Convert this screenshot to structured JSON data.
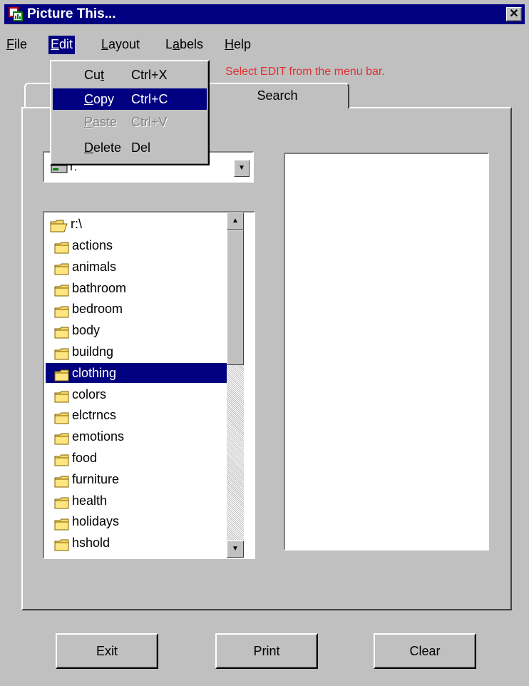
{
  "window": {
    "title": "Picture This...",
    "close_glyph": "✕"
  },
  "menubar": [
    {
      "label": "File",
      "ul": "F",
      "rest": "ile"
    },
    {
      "label": "Edit",
      "ul": "E",
      "rest": "dit"
    },
    {
      "pre": "",
      "label": "Layout",
      "ul": "L",
      "rest": "ayout"
    },
    {
      "label": "Labels",
      "pre": "L",
      "ul": "a",
      "rest": "bels"
    },
    {
      "label": "Help",
      "ul": "H",
      "rest": "elp"
    }
  ],
  "edit_menu": [
    {
      "pre": "Cu",
      "ul": "t",
      "rest": "",
      "accel": "Ctrl+X",
      "state": "normal"
    },
    {
      "pre": "",
      "ul": "C",
      "rest": "opy",
      "accel": "Ctrl+C",
      "state": "selected"
    },
    {
      "pre": "",
      "ul": "P",
      "rest": "aste",
      "accel": "Ctrl+V",
      "state": "disabled"
    },
    {
      "pre": "",
      "ul": "D",
      "rest": "elete",
      "accel": "Del",
      "state": "normal"
    }
  ],
  "hint": "Select EDIT from the menu bar.",
  "tabs": {
    "search": "Search"
  },
  "drive": {
    "value": "r:"
  },
  "folders": {
    "root": "r:\\",
    "items": [
      "actions",
      "animals",
      "bathroom",
      "bedroom",
      "body",
      "buildng",
      "clothing",
      "colors",
      "elctrncs",
      "emotions",
      "food",
      "furniture",
      "health",
      "holidays",
      "hshold"
    ],
    "selected": "clothing"
  },
  "buttons": {
    "exit": "Exit",
    "print": "Print",
    "clear": "Clear"
  },
  "colors": {
    "titlebar": "#000080",
    "highlight": "#000080",
    "hint": "#e03030",
    "face": "#c0c0c0"
  },
  "icons": [
    "app-icon",
    "close-icon",
    "drive-icon",
    "folder-open-icon",
    "folder-icon",
    "scroll-up-arrow-icon",
    "scroll-down-arrow-icon",
    "dropdown-arrow-icon"
  ]
}
